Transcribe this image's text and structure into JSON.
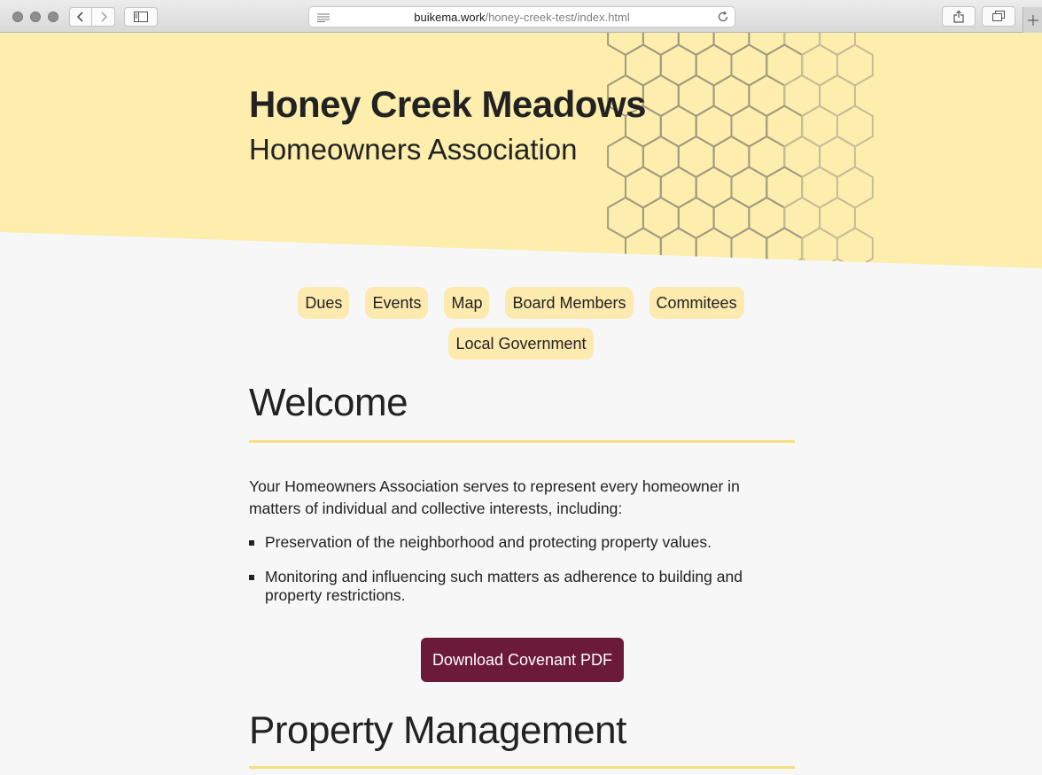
{
  "browser": {
    "url_domain": "buikema.work",
    "url_path": "/honey-creek-test/index.html",
    "icons": [
      "back-icon",
      "forward-icon",
      "sidebar-icon",
      "reader-icon",
      "reload-icon",
      "share-icon",
      "tabs-icon",
      "new-tab-icon"
    ]
  },
  "header": {
    "title": "Honey Creek Meadows",
    "subtitle": "Homeowners Association"
  },
  "nav": {
    "row1": [
      {
        "label": "Dues"
      },
      {
        "label": "Events"
      },
      {
        "label": "Map"
      },
      {
        "label": "Board Members"
      },
      {
        "label": "Commitees"
      }
    ],
    "row2": [
      {
        "label": "Local Government"
      }
    ]
  },
  "welcome": {
    "heading": "Welcome",
    "intro": "Your Homeowners Association serves to represent every homeowner in matters of individual and collective interests, including:",
    "bullets": [
      "Preservation of the neighborhood and protecting property values.",
      "Monitoring and influencing such matters as adherence to building and property restrictions."
    ],
    "download_label": "Download Covenant PDF"
  },
  "property": {
    "heading": "Property Management"
  },
  "colors": {
    "hero_yellow": "#fdeead",
    "pill_yellow": "#fdeaae",
    "accent_rule": "#f7df7e",
    "button_maroon": "#6b1a38",
    "text": "#222222",
    "page_bg": "#f7f7f7"
  }
}
